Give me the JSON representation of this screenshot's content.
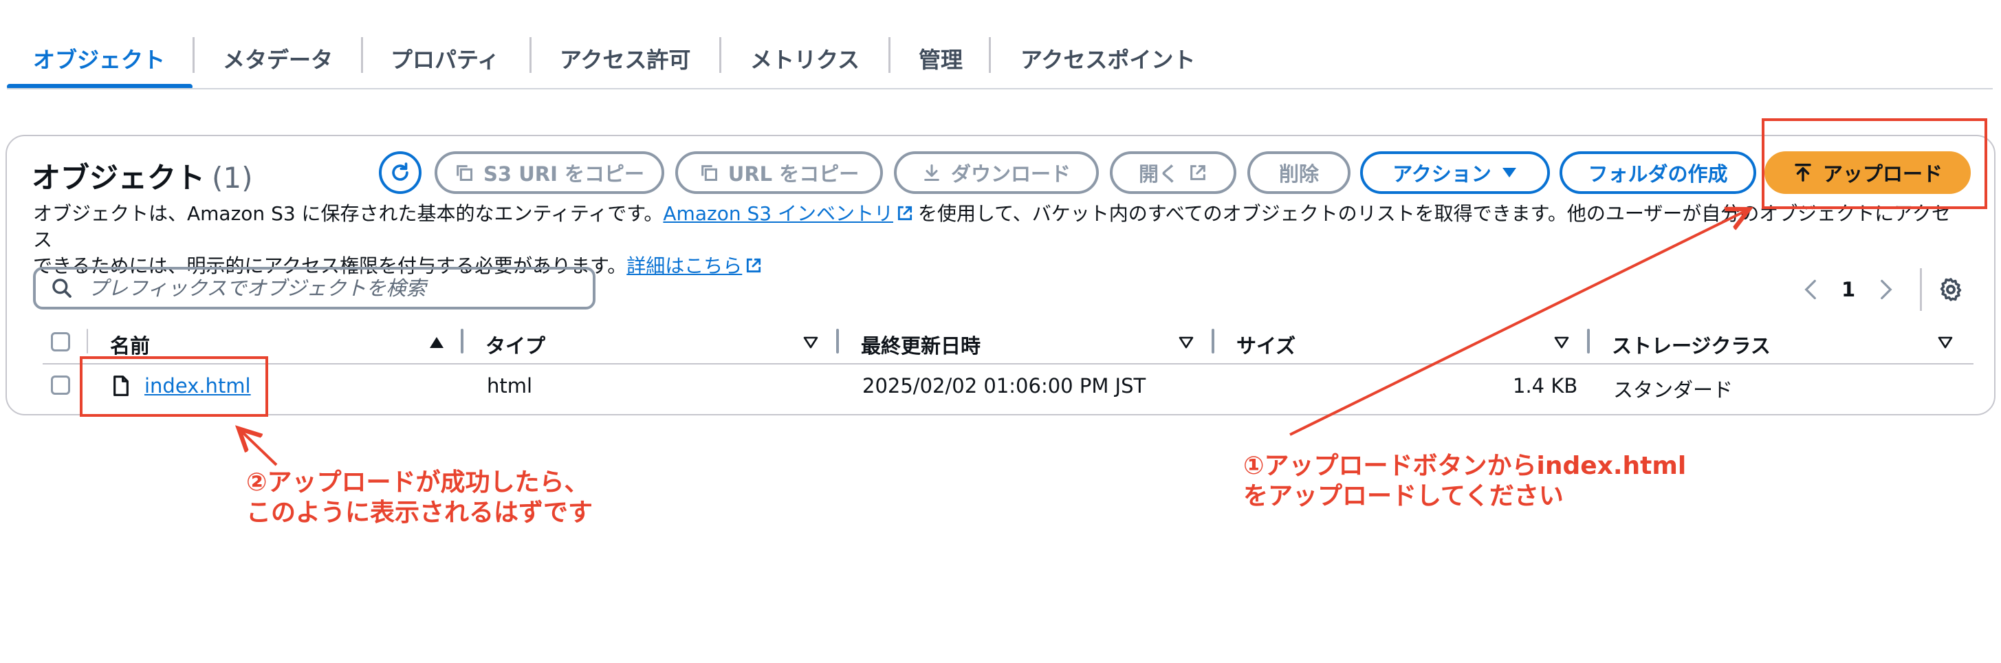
{
  "tabs": [
    {
      "label": "オブジェクト",
      "active": true
    },
    {
      "label": "メタデータ"
    },
    {
      "label": "プロパティ"
    },
    {
      "label": "アクセス許可"
    },
    {
      "label": "メトリクス"
    },
    {
      "label": "管理"
    },
    {
      "label": "アクセスポイント"
    }
  ],
  "panel": {
    "title": "オブジェクト",
    "count": "(1)"
  },
  "toolbar": {
    "copy_s3_uri": "S3 URI をコピー",
    "copy_url": "URL をコピー",
    "download": "ダウンロード",
    "open": "開く",
    "delete": "削除",
    "actions": "アクション",
    "create_folder": "フォルダの作成",
    "upload": "アップロード"
  },
  "description": {
    "part1": "オブジェクトは、Amazon S3 に保存された基本的なエンティティです。",
    "link1": "Amazon S3 インベントリ",
    "part2": "を使用して、バケット内のすべてのオブジェクトのリストを取得できます。他のユーザーが自分のオブジェクトにアクセス",
    "part3": "できるためには、明示的にアクセス権限を付与する必要があります。",
    "link2": "詳細はこちら"
  },
  "search": {
    "placeholder": "プレフィックスでオブジェクトを検索"
  },
  "pagination": {
    "current_page": "1"
  },
  "table": {
    "columns": [
      "名前",
      "タイプ",
      "最終更新日時",
      "サイズ",
      "ストレージクラス"
    ],
    "rows": [
      {
        "name": "index.html",
        "type": "html",
        "last_modified": "2025/02/02 01:06:00 PM JST",
        "size": "1.4 KB",
        "storage_class": "スタンダード"
      }
    ]
  },
  "annotations": {
    "step1_line1": "①アップロードボタンからindex.html",
    "step1_line2": "をアップロードしてください",
    "step2_line1": "②アップロードが成功したら、",
    "step2_line2": "このように表示されるはずです"
  },
  "colors": {
    "accent": "#0972d3",
    "primary_button": "#f3a233",
    "disabled": "#8d99a8",
    "annotation": "#e8432e"
  }
}
